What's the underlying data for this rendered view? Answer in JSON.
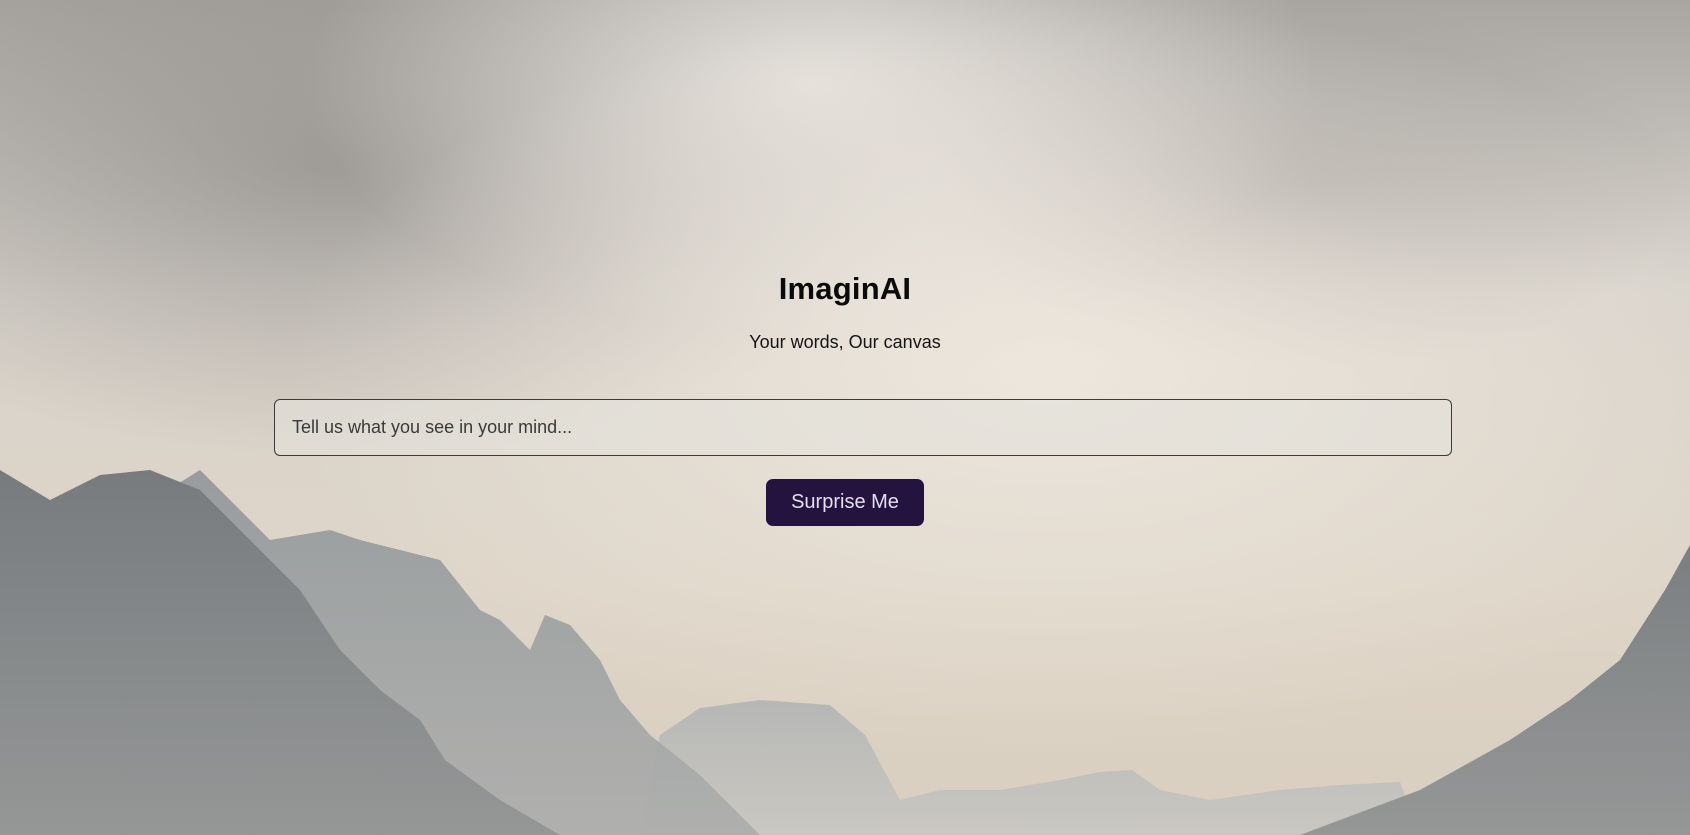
{
  "app": {
    "title": "ImaginAI",
    "tagline": "Your words, Our canvas"
  },
  "prompt": {
    "placeholder": "Tell us what you see in your mind...",
    "value": ""
  },
  "actions": {
    "surprise_label": "Surprise Me"
  },
  "colors": {
    "button_background": "#24123f",
    "button_text": "#e4e0ee",
    "title_text": "#0a0a0a"
  },
  "background": {
    "icon": "mountain-landscape-image"
  }
}
